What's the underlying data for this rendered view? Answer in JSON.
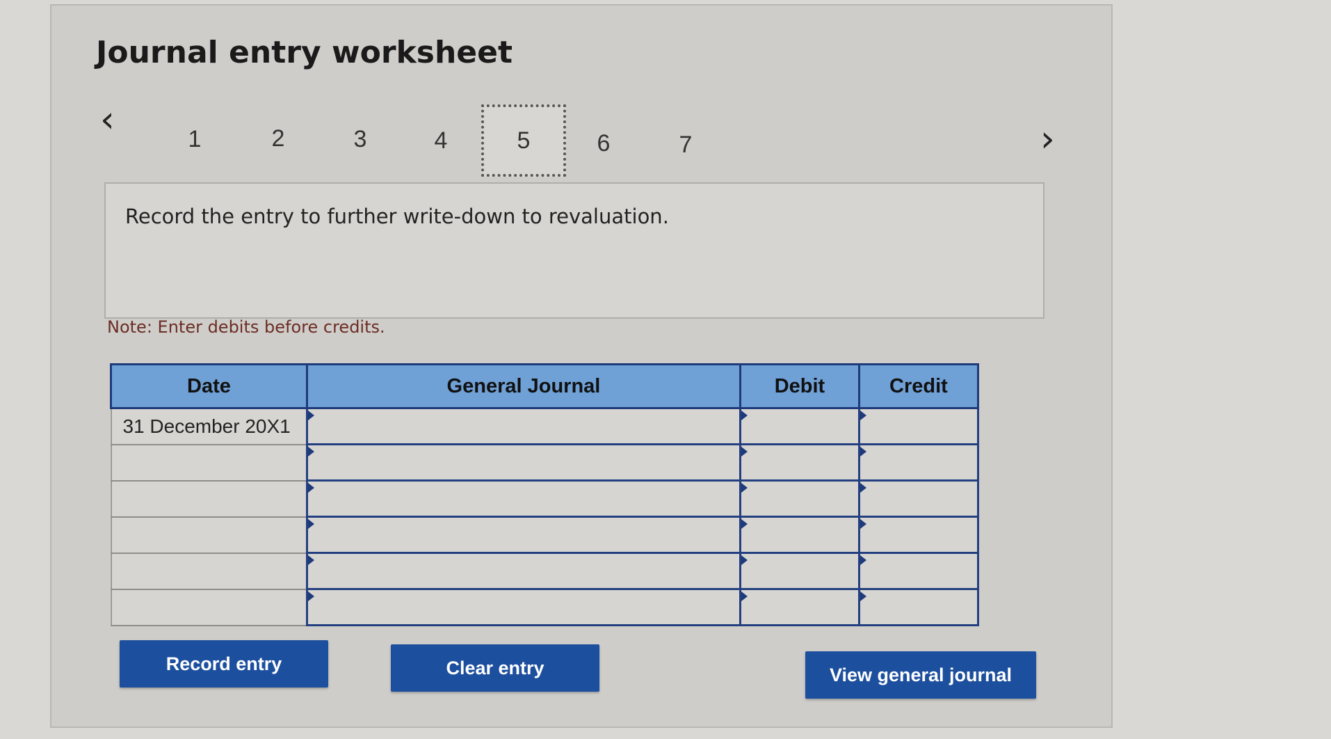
{
  "title": "Journal entry worksheet",
  "nav": {
    "prev_icon": "chevron-left-icon",
    "next_icon": "chevron-right-icon",
    "tabs": [
      "1",
      "2",
      "3",
      "4",
      "5",
      "6",
      "7"
    ],
    "active_tab": "5"
  },
  "instruction": "Record the entry to further write-down to revaluation.",
  "note": "Note: Enter debits before credits.",
  "table": {
    "headers": {
      "date": "Date",
      "journal": "General Journal",
      "debit": "Debit",
      "credit": "Credit"
    },
    "rows": [
      {
        "date": "31 December 20X1",
        "journal": "",
        "debit": "",
        "credit": ""
      },
      {
        "date": "",
        "journal": "",
        "debit": "",
        "credit": ""
      },
      {
        "date": "",
        "journal": "",
        "debit": "",
        "credit": ""
      },
      {
        "date": "",
        "journal": "",
        "debit": "",
        "credit": ""
      },
      {
        "date": "",
        "journal": "",
        "debit": "",
        "credit": ""
      },
      {
        "date": "",
        "journal": "",
        "debit": "",
        "credit": ""
      }
    ]
  },
  "buttons": {
    "record": "Record entry",
    "clear": "Clear entry",
    "view": "View general journal"
  },
  "colors": {
    "header_bg": "#6fa0d6",
    "button_bg": "#1c4f9e",
    "table_border": "#1e3a7a",
    "note_text": "#6b2d24"
  }
}
